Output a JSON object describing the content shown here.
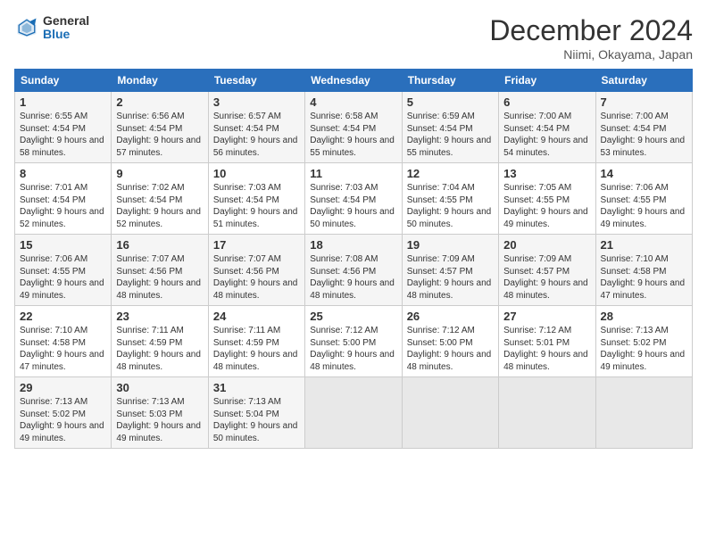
{
  "header": {
    "logo_general": "General",
    "logo_blue": "Blue",
    "month_title": "December 2024",
    "location": "Niimi, Okayama, Japan"
  },
  "weekdays": [
    "Sunday",
    "Monday",
    "Tuesday",
    "Wednesday",
    "Thursday",
    "Friday",
    "Saturday"
  ],
  "weeks": [
    [
      {
        "day": "1",
        "sunrise": "6:55 AM",
        "sunset": "4:54 PM",
        "daylight": "9 hours and 58 minutes."
      },
      {
        "day": "2",
        "sunrise": "6:56 AM",
        "sunset": "4:54 PM",
        "daylight": "9 hours and 57 minutes."
      },
      {
        "day": "3",
        "sunrise": "6:57 AM",
        "sunset": "4:54 PM",
        "daylight": "9 hours and 56 minutes."
      },
      {
        "day": "4",
        "sunrise": "6:58 AM",
        "sunset": "4:54 PM",
        "daylight": "9 hours and 55 minutes."
      },
      {
        "day": "5",
        "sunrise": "6:59 AM",
        "sunset": "4:54 PM",
        "daylight": "9 hours and 55 minutes."
      },
      {
        "day": "6",
        "sunrise": "7:00 AM",
        "sunset": "4:54 PM",
        "daylight": "9 hours and 54 minutes."
      },
      {
        "day": "7",
        "sunrise": "7:00 AM",
        "sunset": "4:54 PM",
        "daylight": "9 hours and 53 minutes."
      }
    ],
    [
      {
        "day": "8",
        "sunrise": "7:01 AM",
        "sunset": "4:54 PM",
        "daylight": "9 hours and 52 minutes."
      },
      {
        "day": "9",
        "sunrise": "7:02 AM",
        "sunset": "4:54 PM",
        "daylight": "9 hours and 52 minutes."
      },
      {
        "day": "10",
        "sunrise": "7:03 AM",
        "sunset": "4:54 PM",
        "daylight": "9 hours and 51 minutes."
      },
      {
        "day": "11",
        "sunrise": "7:03 AM",
        "sunset": "4:54 PM",
        "daylight": "9 hours and 50 minutes."
      },
      {
        "day": "12",
        "sunrise": "7:04 AM",
        "sunset": "4:55 PM",
        "daylight": "9 hours and 50 minutes."
      },
      {
        "day": "13",
        "sunrise": "7:05 AM",
        "sunset": "4:55 PM",
        "daylight": "9 hours and 49 minutes."
      },
      {
        "day": "14",
        "sunrise": "7:06 AM",
        "sunset": "4:55 PM",
        "daylight": "9 hours and 49 minutes."
      }
    ],
    [
      {
        "day": "15",
        "sunrise": "7:06 AM",
        "sunset": "4:55 PM",
        "daylight": "9 hours and 49 minutes."
      },
      {
        "day": "16",
        "sunrise": "7:07 AM",
        "sunset": "4:56 PM",
        "daylight": "9 hours and 48 minutes."
      },
      {
        "day": "17",
        "sunrise": "7:07 AM",
        "sunset": "4:56 PM",
        "daylight": "9 hours and 48 minutes."
      },
      {
        "day": "18",
        "sunrise": "7:08 AM",
        "sunset": "4:56 PM",
        "daylight": "9 hours and 48 minutes."
      },
      {
        "day": "19",
        "sunrise": "7:09 AM",
        "sunset": "4:57 PM",
        "daylight": "9 hours and 48 minutes."
      },
      {
        "day": "20",
        "sunrise": "7:09 AM",
        "sunset": "4:57 PM",
        "daylight": "9 hours and 48 minutes."
      },
      {
        "day": "21",
        "sunrise": "7:10 AM",
        "sunset": "4:58 PM",
        "daylight": "9 hours and 47 minutes."
      }
    ],
    [
      {
        "day": "22",
        "sunrise": "7:10 AM",
        "sunset": "4:58 PM",
        "daylight": "9 hours and 47 minutes."
      },
      {
        "day": "23",
        "sunrise": "7:11 AM",
        "sunset": "4:59 PM",
        "daylight": "9 hours and 48 minutes."
      },
      {
        "day": "24",
        "sunrise": "7:11 AM",
        "sunset": "4:59 PM",
        "daylight": "9 hours and 48 minutes."
      },
      {
        "day": "25",
        "sunrise": "7:12 AM",
        "sunset": "5:00 PM",
        "daylight": "9 hours and 48 minutes."
      },
      {
        "day": "26",
        "sunrise": "7:12 AM",
        "sunset": "5:00 PM",
        "daylight": "9 hours and 48 minutes."
      },
      {
        "day": "27",
        "sunrise": "7:12 AM",
        "sunset": "5:01 PM",
        "daylight": "9 hours and 48 minutes."
      },
      {
        "day": "28",
        "sunrise": "7:13 AM",
        "sunset": "5:02 PM",
        "daylight": "9 hours and 49 minutes."
      }
    ],
    [
      {
        "day": "29",
        "sunrise": "7:13 AM",
        "sunset": "5:02 PM",
        "daylight": "9 hours and 49 minutes."
      },
      {
        "day": "30",
        "sunrise": "7:13 AM",
        "sunset": "5:03 PM",
        "daylight": "9 hours and 49 minutes."
      },
      {
        "day": "31",
        "sunrise": "7:13 AM",
        "sunset": "5:04 PM",
        "daylight": "9 hours and 50 minutes."
      },
      null,
      null,
      null,
      null
    ]
  ]
}
